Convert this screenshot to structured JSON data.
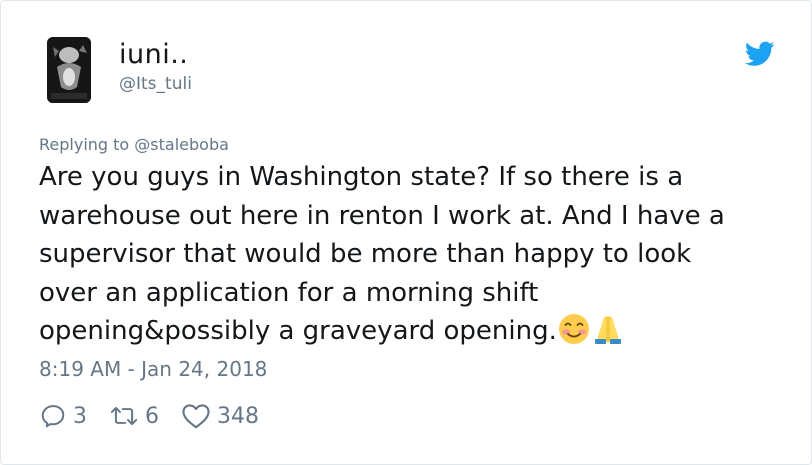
{
  "author": {
    "display_name": "iuni..",
    "handle": "@Its_tuli"
  },
  "icons": {
    "brand": "twitter-bird-icon",
    "reply": "reply-icon",
    "retweet": "retweet-icon",
    "like": "heart-icon",
    "emoji_1": "smiling-face-emoji",
    "emoji_2": "folded-hands-emoji"
  },
  "colors": {
    "brand_blue": "#1da1f2",
    "secondary_text": "#657786",
    "primary_text": "#14171a",
    "border": "#e1e8ed"
  },
  "tweet": {
    "replying_to_prefix": "Replying to",
    "replying_to_handle": "@staleboba",
    "text_lines": [
      "Are you guys in Washington state? If so there is a",
      "warehouse out here in renton I work at. And I have a",
      "supervisor that would be more than happy to look",
      "over an application for a morning shift",
      "opening&possibly a graveyard opening."
    ],
    "timestamp": "8:19 AM - Jan 24, 2018"
  },
  "stats": {
    "replies": "3",
    "retweets": "6",
    "likes": "348"
  }
}
